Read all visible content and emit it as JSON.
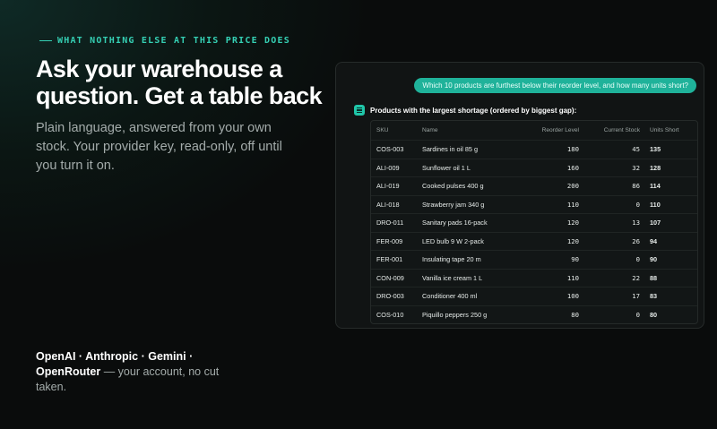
{
  "eyebrow": "WHAT NOTHING ELSE AT THIS PRICE DOES",
  "headline": "Ask your warehouse a question. Get a table back",
  "subtitle": "Plain language, answered from your own stock. Your provider key, read-only, off until you turn it on.",
  "providers": {
    "names": "OpenAI · Anthropic · Gemini · OpenRouter",
    "rest": " — your account, no cut taken."
  },
  "chat": {
    "question": "Which 10 products are furthest below their reorder level, and how many units short?",
    "answer_title": "Products with the largest shortage (ordered by biggest gap):",
    "columns": [
      "SKU",
      "Name",
      "Reorder Level",
      "Current Stock",
      "Units Short"
    ],
    "rows": [
      {
        "sku": "COS-003",
        "name": "Sardines in oil 85 g",
        "reorder": "180",
        "stock": "45",
        "short": "135"
      },
      {
        "sku": "ALI-009",
        "name": "Sunflower oil 1 L",
        "reorder": "160",
        "stock": "32",
        "short": "128"
      },
      {
        "sku": "ALI-019",
        "name": "Cooked pulses 400 g",
        "reorder": "200",
        "stock": "86",
        "short": "114"
      },
      {
        "sku": "ALI-018",
        "name": "Strawberry jam 340 g",
        "reorder": "110",
        "stock": "0",
        "short": "110"
      },
      {
        "sku": "DRO-011",
        "name": "Sanitary pads 16-pack",
        "reorder": "120",
        "stock": "13",
        "short": "107"
      },
      {
        "sku": "FER-009",
        "name": "LED bulb 9 W 2-pack",
        "reorder": "120",
        "stock": "26",
        "short": "94"
      },
      {
        "sku": "FER-001",
        "name": "Insulating tape 20 m",
        "reorder": "90",
        "stock": "0",
        "short": "90"
      },
      {
        "sku": "CON-009",
        "name": "Vanilla ice cream 1 L",
        "reorder": "110",
        "stock": "22",
        "short": "88"
      },
      {
        "sku": "DRO-003",
        "name": "Conditioner 400 ml",
        "reorder": "100",
        "stock": "17",
        "short": "83"
      },
      {
        "sku": "COS-010",
        "name": "Piquillo peppers 250 g",
        "reorder": "80",
        "stock": "0",
        "short": "80"
      }
    ]
  },
  "colors": {
    "accent": "#35d0b4",
    "bubble": "#1fb29a",
    "background": "#0a0c0c"
  },
  "icons": {
    "eyebrow": "dash-line-icon",
    "answer": "table-lines-icon"
  }
}
